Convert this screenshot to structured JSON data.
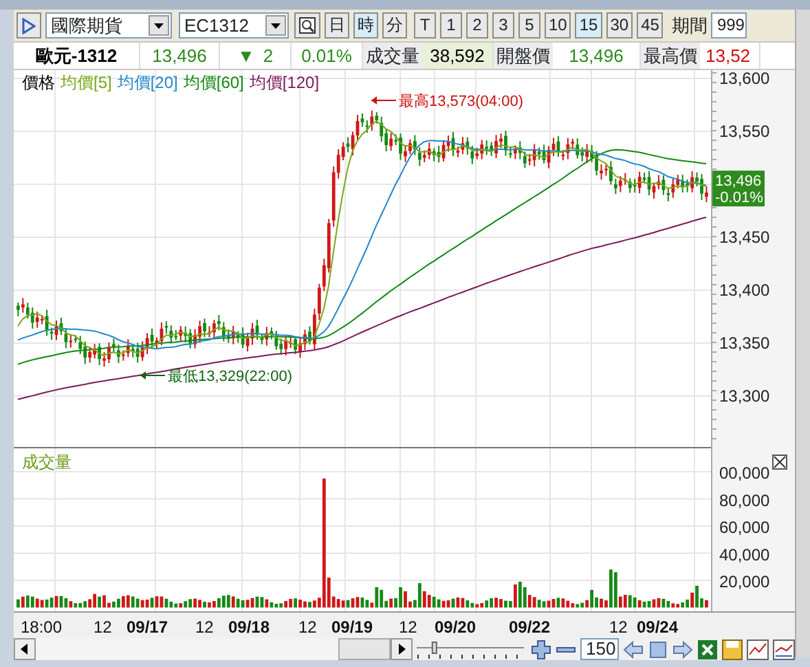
{
  "toolbar": {
    "exchange_select": {
      "value": "國際期貨"
    },
    "symbol_select": {
      "value": "EC1312"
    },
    "period_buttons": [
      {
        "label": "日",
        "selected": false
      },
      {
        "label": "時",
        "selected": true
      },
      {
        "label": "分",
        "selected": false
      },
      {
        "label": "T",
        "selected": false
      },
      {
        "label": "1",
        "selected": false
      },
      {
        "label": "2",
        "selected": false
      },
      {
        "label": "3",
        "selected": false
      },
      {
        "label": "5",
        "selected": false
      },
      {
        "label": "10",
        "selected": false
      },
      {
        "label": "15",
        "selected": true
      },
      {
        "label": "30",
        "selected": false
      },
      {
        "label": "45",
        "selected": false
      }
    ],
    "period_label": "期間",
    "period_field": {
      "value": "999"
    }
  },
  "quote": {
    "name": "歐元-1312",
    "last": "13,496",
    "change_arrow": "▼",
    "change": "2",
    "percent": "0.01%",
    "fields": [
      {
        "label": "成交量",
        "value": "38,592",
        "color": "#000000"
      },
      {
        "label": "開盤價",
        "value": "13,496",
        "color": "#2e8b1e"
      },
      {
        "label": "最高價",
        "value": "13,52",
        "color": "#d01010"
      }
    ]
  },
  "price_chart": {
    "legend": [
      {
        "label": "價格",
        "color": "#000000"
      },
      {
        "label": "均價[5]",
        "color": "#7aa814"
      },
      {
        "label": "均價[20]",
        "color": "#2288cc"
      },
      {
        "label": "均價[60]",
        "color": "#128a12"
      },
      {
        "label": "均價[120]",
        "color": "#7a1a5a"
      }
    ],
    "annotations": [
      {
        "kind": "high",
        "text": "最高13,573(04:00)"
      },
      {
        "kind": "low",
        "text": "最低13,329(22:00)"
      }
    ],
    "axis_labels": [
      "13,600",
      "13,550",
      "13,450",
      "13,400",
      "13,350",
      "13,300"
    ],
    "last_tag": {
      "price": "13,496",
      "change": "-0.01%"
    }
  },
  "volume_chart": {
    "title": "成交量",
    "axis_labels": [
      "00,000",
      "80,000",
      "60,000",
      "40,000",
      "20,000"
    ]
  },
  "time_axis": [
    {
      "label": "18:00",
      "bold": false
    },
    {
      "label": "12",
      "bold": false
    },
    {
      "label": "09/17",
      "bold": true
    },
    {
      "label": "12",
      "bold": false
    },
    {
      "label": "09/18",
      "bold": true
    },
    {
      "label": "12",
      "bold": false
    },
    {
      "label": "09/19",
      "bold": true
    },
    {
      "label": "12",
      "bold": false
    },
    {
      "label": "09/20",
      "bold": true
    },
    {
      "label": "09/22",
      "bold": true
    },
    {
      "label": "12",
      "bold": false
    },
    {
      "label": "09/24",
      "bold": true
    }
  ],
  "controls": {
    "zoom_slider": {
      "level": 0.15
    },
    "bar_count_field": {
      "value": "150"
    }
  }
}
